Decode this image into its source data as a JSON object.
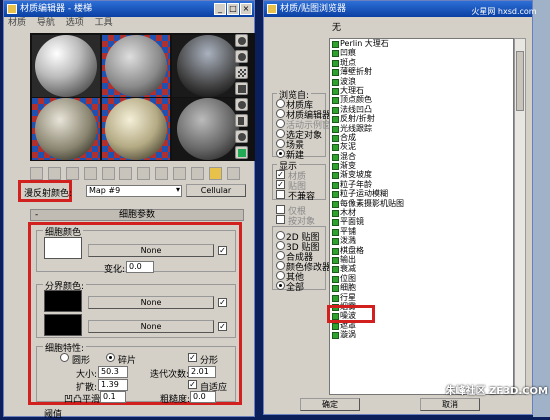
{
  "watermark_top": "火星网 hxsd.com",
  "watermark_bottom": "朱峰社区 ZF3D.COM",
  "editor": {
    "title": "材质编辑器 - 楼梯",
    "menu": [
      "材质",
      "导航",
      "选项",
      "工具"
    ],
    "map_type_label": "漫反射颜色:",
    "map_name": "Map #9",
    "map_type_button": "Cellular",
    "rollout_title": "细胞参数",
    "cell_color": {
      "label": "细胞颜色",
      "map_button": "None",
      "variation_label": "变化:",
      "variation_value": "0.0"
    },
    "division_colors": {
      "label": "分界颜色:",
      "button1": "None",
      "button2": "None"
    },
    "characteristics": {
      "label": "细胞特性:",
      "radio_circular": "圆形",
      "radio_chips": "碎片",
      "fractal_label": "分形",
      "size_label": "大小:",
      "size_value": "50.3",
      "iterations_label": "迭代次数:",
      "iterations_value": "2.01",
      "spread_label": "扩散:",
      "spread_value": "1.39",
      "adaptive_label": "自适应",
      "bump_label": "凹凸平滑:",
      "bump_value": "0.1",
      "roughness_label": "粗糙度:",
      "roughness_value": "0.0"
    },
    "bottom_label": "阈值"
  },
  "browser": {
    "title": "材质/贴图浏览器",
    "current": "无",
    "browse_from": {
      "label": "浏览自:",
      "options": [
        "材质库",
        "材质编辑器",
        "活动示例窗",
        "选定对象",
        "场景",
        "新建"
      ]
    },
    "show": {
      "label": "显示",
      "options": [
        "材质",
        "贴图",
        "不兼容"
      ]
    },
    "extra_checks": [
      "仅根",
      "按对象"
    ],
    "filters": [
      "2D 贴图",
      "3D 贴图",
      "合成器",
      "颜色修改器",
      "其他",
      "全部"
    ],
    "list": [
      "Perlin 大理石",
      "凹痕",
      "斑点",
      "薄壁折射",
      "波浪",
      "大理石",
      "顶点颜色",
      "法线凹凸",
      "反射/折射",
      "光线跟踪",
      "合成",
      "灰泥",
      "混合",
      "渐变",
      "渐变坡度",
      "粒子年龄",
      "粒子运动模糊",
      "每像素摄影机贴图",
      "木材",
      "平面镜",
      "平铺",
      "泼溅",
      "棋盘格",
      "输出",
      "衰减",
      "位图",
      "细胞",
      "行星",
      "烟雾",
      "噪波",
      "遮罩",
      "漩涡"
    ],
    "selected_index": 26,
    "ok_button": "确定",
    "cancel_button": "取消"
  }
}
